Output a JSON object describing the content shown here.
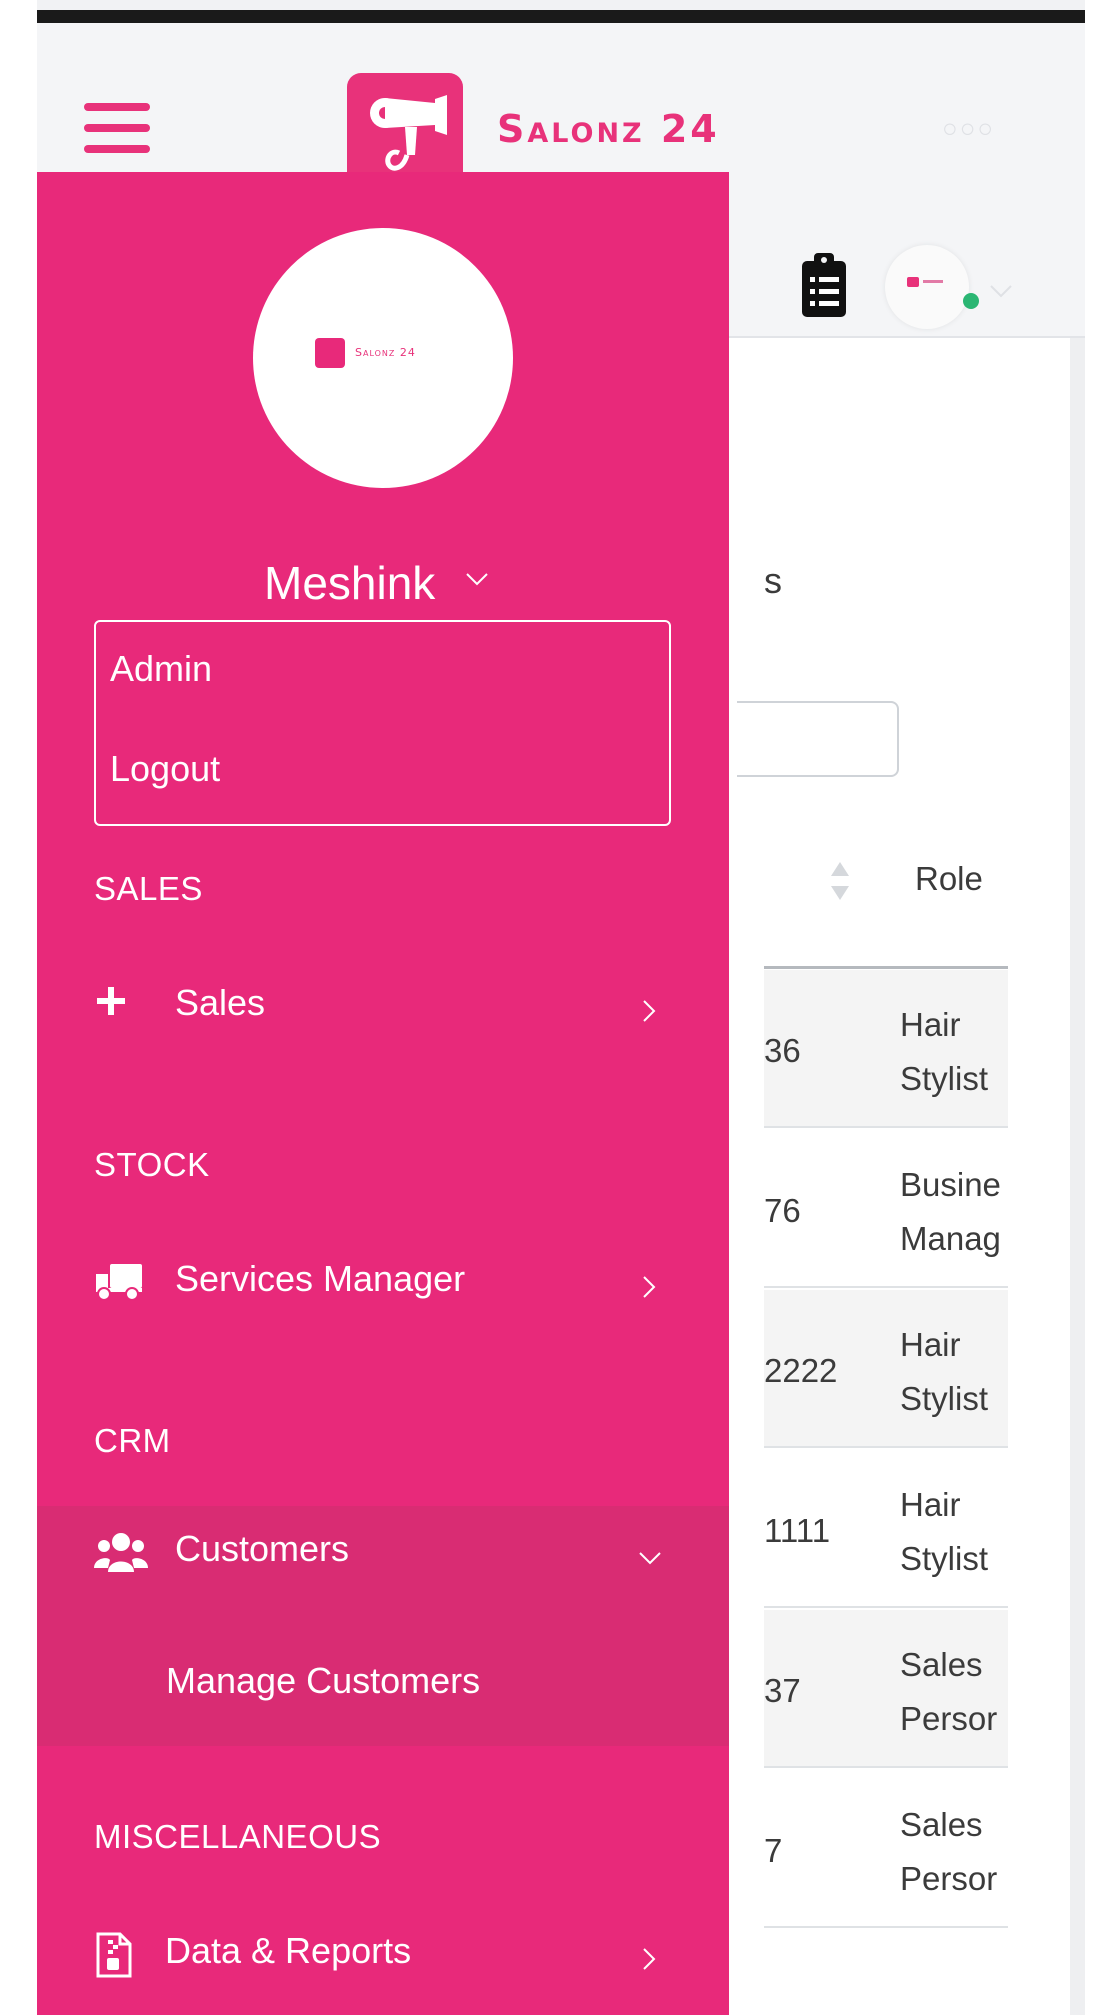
{
  "app": {
    "brand_name": "Salonz 24",
    "more_dots": "○○○"
  },
  "content": {
    "section_fragment": "s",
    "role_header": "Role",
    "rows": [
      {
        "id_fragment": "36",
        "role_line1": "Hair",
        "role_line2": "Stylist"
      },
      {
        "id_fragment": "76",
        "role_line1": "Busine",
        "role_line2": "Manag"
      },
      {
        "id_fragment": "2222",
        "role_line1": "Hair",
        "role_line2": "Stylist"
      },
      {
        "id_fragment": "1111",
        "role_line1": "Hair",
        "role_line2": "Stylist"
      },
      {
        "id_fragment": "37",
        "role_line1": "Sales",
        "role_line2": "Persor"
      },
      {
        "id_fragment": "7",
        "role_line1": "Sales",
        "role_line2": "Persor"
      }
    ]
  },
  "drawer": {
    "profile_brand": "Salonz 24",
    "user_name": "Meshink",
    "user_menu": {
      "admin": "Admin",
      "logout": "Logout"
    },
    "sections": {
      "sales": {
        "header": "SALES",
        "item_label": "Sales",
        "icon": "plus-icon"
      },
      "stock": {
        "header": "STOCK",
        "item_label": "Services Manager",
        "icon": "truck-icon"
      },
      "crm": {
        "header": "CRM",
        "item_label": "Customers",
        "icon": "users-icon",
        "submenu": "Manage Customers"
      },
      "misc": {
        "header": "MISCELLANEOUS",
        "item_label": "Data & Reports",
        "icon": "file-archive-icon"
      }
    }
  },
  "colors": {
    "brand_pink": "#e8297a",
    "expanded_bg": "#d92c73",
    "online_green": "#2bb673"
  }
}
